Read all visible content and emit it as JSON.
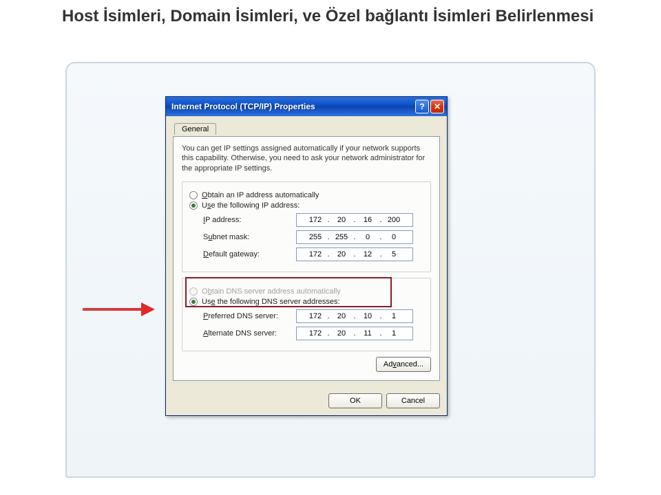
{
  "page": {
    "title": "Host İsimleri, Domain İsimleri, ve Özel bağlantı İsimleri Belirlenmesi"
  },
  "dialog": {
    "title": "Internet Protocol (TCP/IP) Properties",
    "help_symbol": "?",
    "close_symbol": "✕",
    "tab_general": "General",
    "description": "You can get IP settings assigned automatically if your network supports this capability. Otherwise, you need to ask your network administrator for the appropriate IP settings.",
    "radio_obtain_ip": "Obtain an IP address automatically",
    "radio_use_ip": "Use the following IP address:",
    "fields": {
      "ip_label": "IP address:",
      "ip": [
        "172",
        "20",
        "16",
        "200"
      ],
      "subnet_label": "Subnet mask:",
      "subnet": [
        "255",
        "255",
        "0",
        "0"
      ],
      "gateway_label": "Default gateway:",
      "gateway": [
        "172",
        "20",
        "12",
        "5"
      ]
    },
    "radio_obtain_dns": "Obtain DNS server address automatically",
    "radio_use_dns": "Use the following DNS server addresses:",
    "dns": {
      "preferred_label": "Preferred DNS server:",
      "preferred": [
        "172",
        "20",
        "10",
        "1"
      ],
      "alternate_label": "Alternate DNS server:",
      "alternate": [
        "172",
        "20",
        "11",
        "1"
      ]
    },
    "advanced_button": "Advanced...",
    "ok_button": "OK",
    "cancel_button": "Cancel"
  }
}
